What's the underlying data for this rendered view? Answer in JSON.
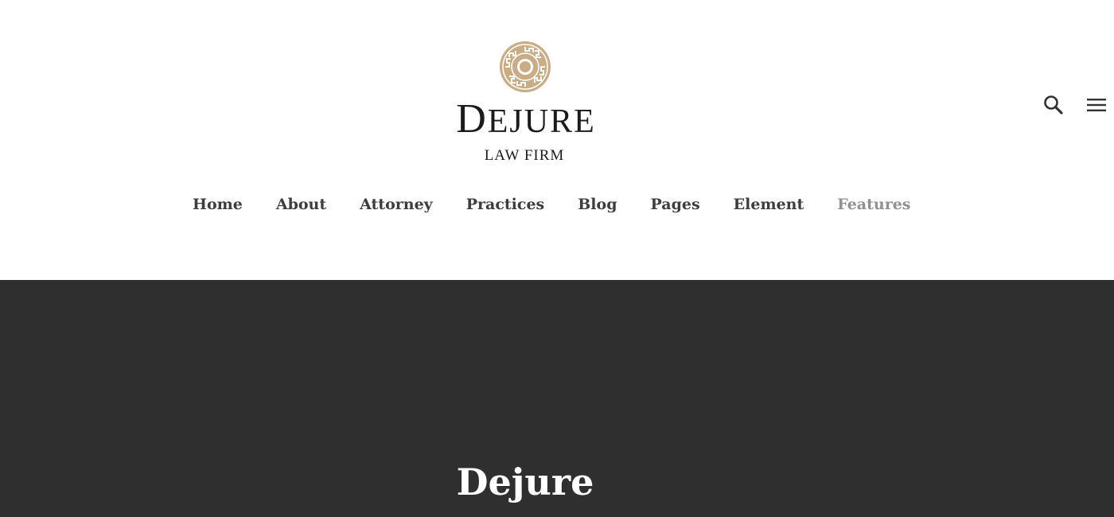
{
  "brand": {
    "name_initial": "D",
    "name_rest": "EJURE",
    "tagline": "LAW FIRM",
    "emblem_color": "#c9ad86",
    "text_color": "#1b1b1b"
  },
  "header_icons": {
    "search": "search-icon",
    "menu": "hamburger-menu-icon"
  },
  "nav": {
    "items": [
      {
        "label": "Home"
      },
      {
        "label": "About"
      },
      {
        "label": "Attorney"
      },
      {
        "label": "Practices"
      },
      {
        "label": "Blog"
      },
      {
        "label": "Pages"
      },
      {
        "label": "Element"
      },
      {
        "label": "Features",
        "active": true
      }
    ],
    "color": "#3d3d3d",
    "active_color": "#909090"
  },
  "hero": {
    "title": "Dejure",
    "background": "#2f2f2f"
  }
}
